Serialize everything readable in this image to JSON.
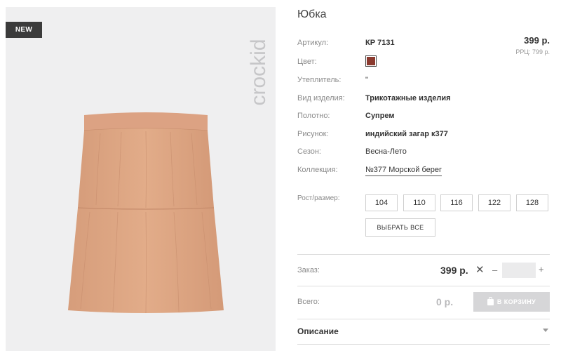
{
  "product": {
    "title": "Юбка",
    "badge": "NEW",
    "brand": "crockid",
    "specs": {
      "article": {
        "label": "Артикул:",
        "value": "КР 7131"
      },
      "color": {
        "label": "Цвет:",
        "swatch_color": "#8b3a2f"
      },
      "insulation": {
        "label": "Утеплитель:",
        "value": "\""
      },
      "type": {
        "label": "Вид изделия:",
        "value": "Трикотажные изделия"
      },
      "fabric": {
        "label": "Полотно:",
        "value": "Супрем"
      },
      "pattern": {
        "label": "Рисунок:",
        "value": "индийский загар к377"
      },
      "season": {
        "label": "Сезон:",
        "value": "Весна-Лето"
      },
      "collection": {
        "label": "Коллекция:",
        "value": "№377 Морской берег"
      }
    },
    "price": "399 р.",
    "rrp": "РРЦ: 799 р."
  },
  "sizes": {
    "label": "Рост/размер:",
    "options": [
      "104",
      "110",
      "116",
      "122",
      "128"
    ],
    "select_all": "ВЫБРАТЬ ВСЕ"
  },
  "order": {
    "label": "Заказ:",
    "price": "399 р.",
    "quantity": ""
  },
  "total": {
    "label": "Всего:",
    "value": "0 р.",
    "cart_button": "В КОРЗИНУ"
  },
  "description": {
    "label": "Описание"
  }
}
